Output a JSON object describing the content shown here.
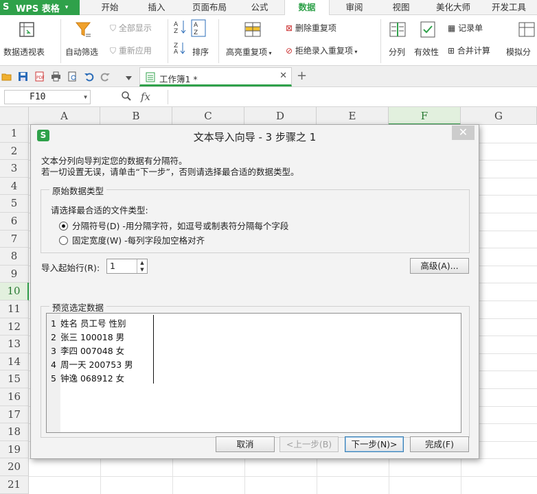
{
  "app": {
    "name": "WPS 表格"
  },
  "menu_tabs": [
    {
      "label": "开始"
    },
    {
      "label": "插入"
    },
    {
      "label": "页面布局"
    },
    {
      "label": "公式"
    },
    {
      "label": "数据"
    },
    {
      "label": "审阅"
    },
    {
      "label": "视图"
    },
    {
      "label": "美化大师"
    },
    {
      "label": "开发工具"
    }
  ],
  "ribbon": {
    "pivot": "数据透视表",
    "autofilter": "自动筛选",
    "show_all": "全部显示",
    "reapply": "重新应用",
    "sort": "排序",
    "highlight_dup": "高亮重复项",
    "delete_dup": "删除重复项",
    "reject_dup": "拒绝录入重复项",
    "split": "分列",
    "validity": "有效性",
    "record": "记录单",
    "consolidate": "合并计算",
    "simulate": "模拟分"
  },
  "document": {
    "tab_label": "工作簿1 *"
  },
  "formula_bar": {
    "cell_ref": "F10",
    "fx": "fx"
  },
  "grid": {
    "columns": [
      "A",
      "B",
      "C",
      "D",
      "E",
      "F",
      "G"
    ],
    "rows": [
      "1",
      "2",
      "3",
      "4",
      "5",
      "6",
      "7",
      "8",
      "9",
      "10",
      "11",
      "12",
      "13",
      "14",
      "15",
      "16",
      "17",
      "18",
      "19",
      "20",
      "21"
    ]
  },
  "dialog": {
    "title": "文本导入向导 - 3 步骤之 1",
    "desc_line1": "文本分列向导判定您的数据有分隔符。",
    "desc_line2": "若一切设置无误，请单击“下一步”，否则请选择最合适的数据类型。",
    "group_title": "原始数据类型",
    "prompt": "请选择最合适的文件类型:",
    "option_delimited": "分隔符号(D)  -用分隔字符，如逗号或制表符分隔每个字段",
    "option_fixed": "固定宽度(W)  -每列字段加空格对齐",
    "start_row_label": "导入起始行(R):",
    "start_row_value": "1",
    "advanced_button": "高级(A)...",
    "preview_title": "预览选定数据",
    "preview_rows": [
      {
        "n": "1",
        "text": "姓名  员工号  性别"
      },
      {
        "n": "2",
        "text": "张三   100018   男"
      },
      {
        "n": "3",
        "text": "李四   007048   女"
      },
      {
        "n": "4",
        "text": "周一天   200753   男"
      },
      {
        "n": "5",
        "text": "钟逸   068912   女"
      }
    ],
    "cancel_button": "取消",
    "back_button": "<上一步(B)",
    "next_button": "下一步(N)>",
    "finish_button": "完成(F)"
  },
  "colors": {
    "accent": "#2fa14a"
  }
}
